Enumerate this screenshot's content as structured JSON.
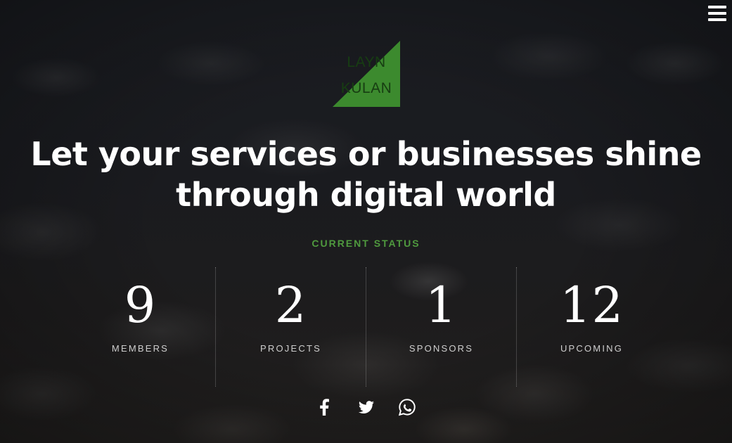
{
  "logo": {
    "line1": "LAYN",
    "line2": "KULAN",
    "color": "#3c8a2e"
  },
  "headline": {
    "line1": "Let your services or businesses shine",
    "line2": "through digital world"
  },
  "status": {
    "title": "CURRENT STATUS",
    "accent_color": "#4f9a3e",
    "items": [
      {
        "number": "9",
        "label": "MEMBERS"
      },
      {
        "number": "2",
        "label": "PROJECTS"
      },
      {
        "number": "1",
        "label": "SPONSORS"
      },
      {
        "number": "12",
        "label": "UPCOMING"
      }
    ]
  },
  "social": [
    {
      "icon": "facebook-icon"
    },
    {
      "icon": "twitter-icon"
    },
    {
      "icon": "whatsapp-icon"
    }
  ],
  "nav": {
    "icon": "hamburger-menu-icon"
  }
}
